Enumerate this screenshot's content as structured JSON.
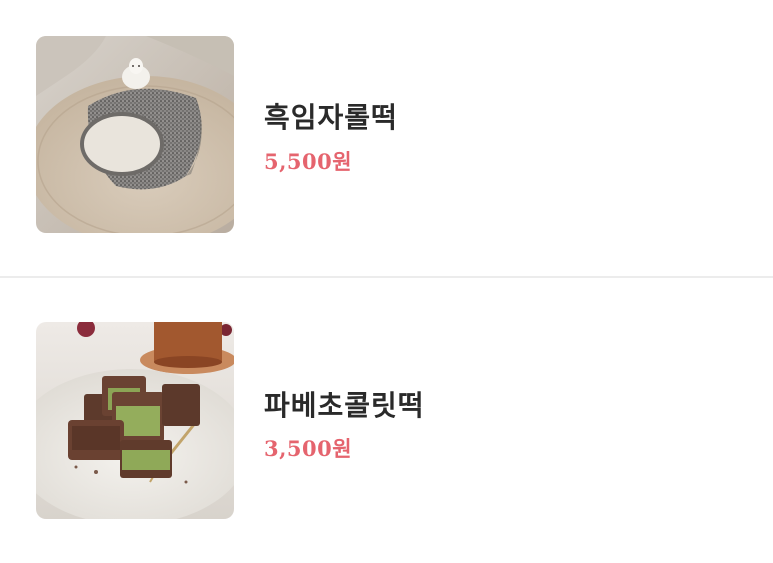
{
  "menu": {
    "items": [
      {
        "name": "흑임자롤떡",
        "price": "5,500원",
        "image": "black-sesame-roll-cake-photo"
      },
      {
        "name": "파베초콜릿떡",
        "price": "3,500원",
        "image": "pave-chocolate-rice-cake-photo"
      }
    ]
  },
  "colors": {
    "price": "#e5646e",
    "name": "#2a2a2a",
    "divider": "#ececec",
    "background": "#ffffff"
  }
}
